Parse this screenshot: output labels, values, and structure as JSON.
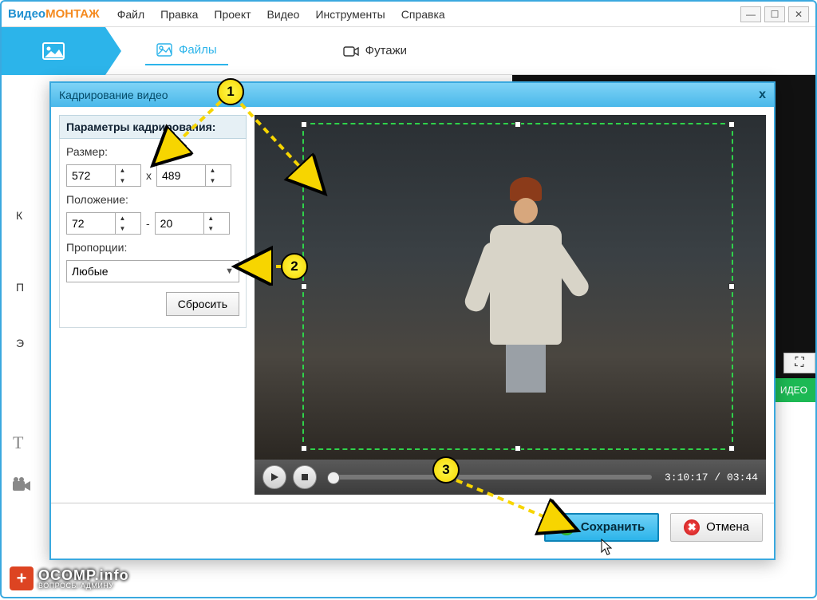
{
  "app": {
    "brand1": "Видео",
    "brand2": "МОНТАЖ"
  },
  "menu": [
    "Файл",
    "Правка",
    "Проект",
    "Видео",
    "Инструменты",
    "Справка"
  ],
  "tabs": {
    "files": "Файлы",
    "footage": "Футажи"
  },
  "bg_badge": "ИДЕО",
  "left_letters": [
    "К",
    "П",
    "Э"
  ],
  "dialog": {
    "title": "Кадрирование видео",
    "panel_head": "Параметры кадрирования:",
    "size_label": "Размер:",
    "width": "572",
    "height": "489",
    "pos_label": "Положение:",
    "pos_x": "72",
    "pos_y": "20",
    "ratio_label": "Пропорции:",
    "ratio_value": "Любые",
    "reset": "Сбросить",
    "time": "3:10:17 / 03:44",
    "save": "Сохранить",
    "cancel": "Отмена",
    "x_sep": "x",
    "dash_sep": "-"
  },
  "callouts": {
    "n1": "1",
    "n2": "2",
    "n3": "3"
  },
  "watermark": {
    "site": "OCOMP.info",
    "tag": "ВОПРОСЫ АДМИНУ"
  }
}
